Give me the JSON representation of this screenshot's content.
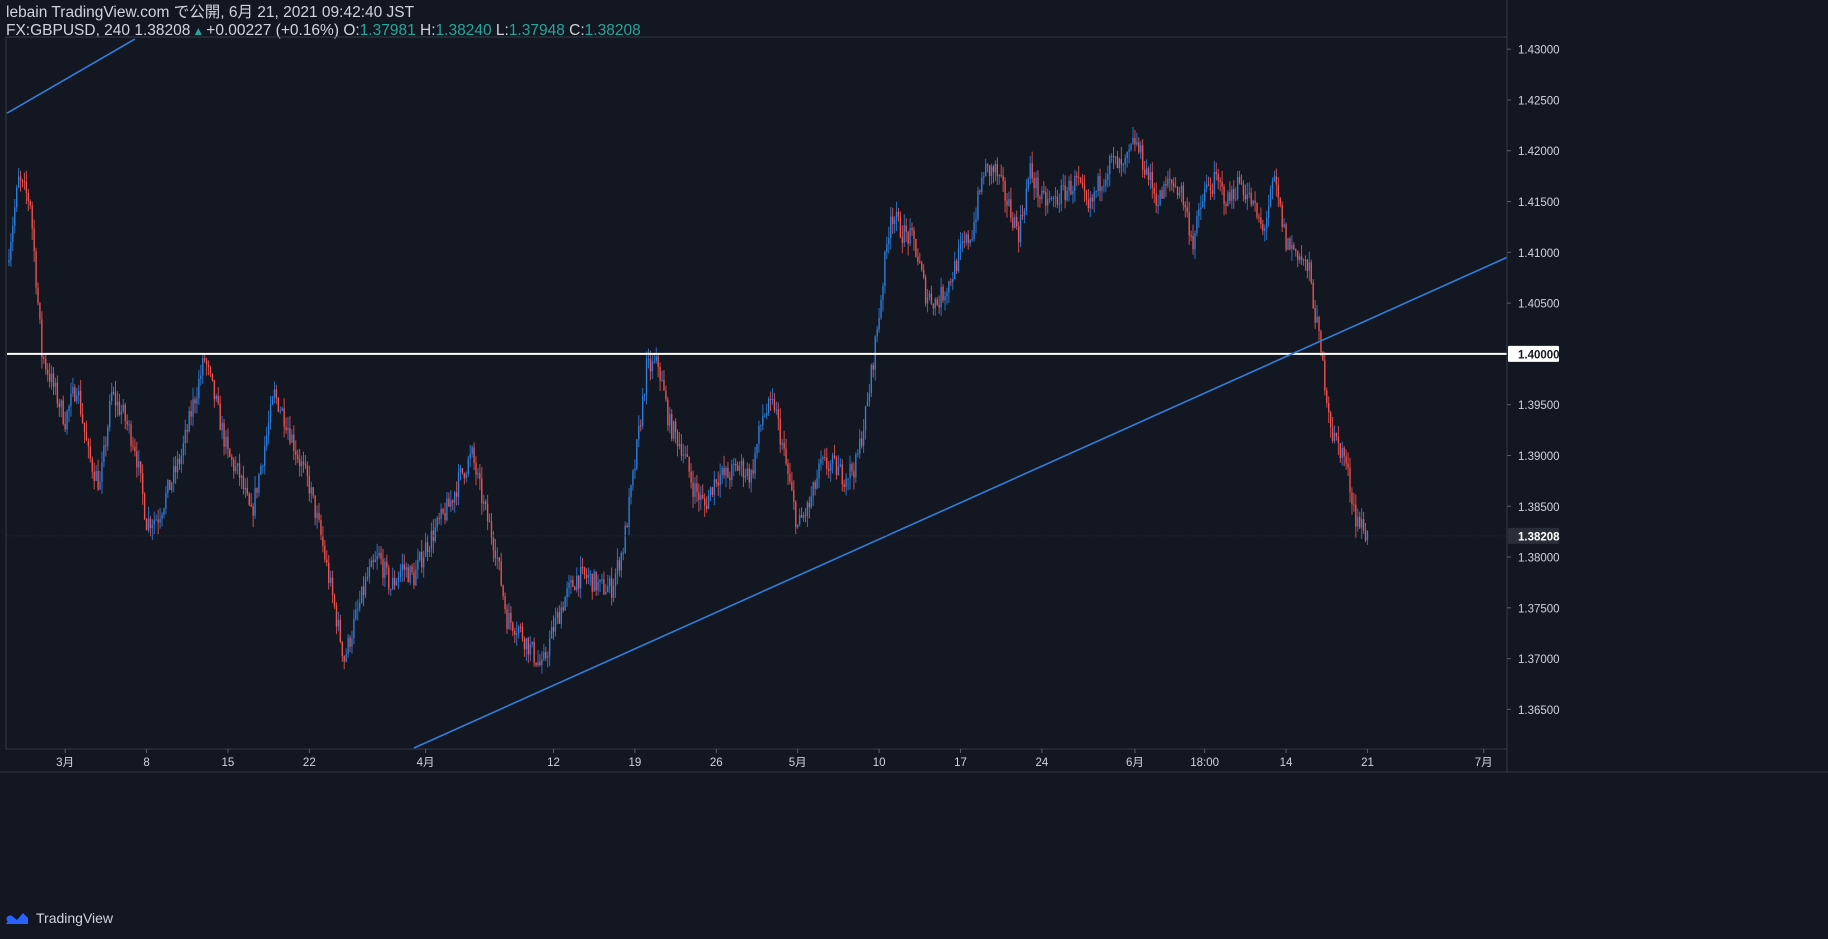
{
  "header": {
    "publisher": "lebain TradingView.com で公開, 6月 21, 2021 09:42:40 JST",
    "symbol": "FX:GBPUSD, 240",
    "last": "1.38208",
    "change": "+0.00227 (+0.16%)",
    "o_label": "O:",
    "o_value": "1.37981",
    "h_label": "H:",
    "h_value": "1.38240",
    "l_label": "L:",
    "l_value": "1.37948",
    "c_label": "C:",
    "c_value": "1.38208"
  },
  "footer": {
    "brand": "TradingView"
  },
  "colors": {
    "background": "#131722",
    "up": "#2f7fdc",
    "down": "#ef5350",
    "trendline": "#2f7fdc",
    "level": "#ffffff",
    "text": "#d1d4dc",
    "value_green": "#26a69a"
  },
  "chart_data": {
    "type": "candlestick",
    "symbol": "FX:GBPUSD",
    "timeframe": "240",
    "x_range": [
      "2021-02-24",
      "2021-07-03"
    ],
    "ylim": [
      1.3612,
      1.4311
    ],
    "y_ticks": [
      "1.43000",
      "1.42500",
      "1.42000",
      "1.41500",
      "1.41000",
      "1.40500",
      "1.40000",
      "1.39500",
      "1.39000",
      "1.38500",
      "1.38208",
      "1.38000",
      "1.37500",
      "1.37000",
      "1.36500"
    ],
    "highlighted_levels": [
      {
        "value": 1.4,
        "label": "1.40000",
        "style": "white"
      },
      {
        "value": 1.38208,
        "label": "1.38208",
        "style": "dark"
      }
    ],
    "x_ticks": [
      {
        "date": "2021-03-01",
        "label": "3月"
      },
      {
        "date": "2021-03-08",
        "label": "8"
      },
      {
        "date": "2021-03-15",
        "label": "15"
      },
      {
        "date": "2021-03-22",
        "label": "22"
      },
      {
        "date": "2021-04-01",
        "label": "4月"
      },
      {
        "date": "2021-04-12",
        "label": "12"
      },
      {
        "date": "2021-04-19",
        "label": "19"
      },
      {
        "date": "2021-04-26",
        "label": "26"
      },
      {
        "date": "2021-05-03",
        "label": "5月"
      },
      {
        "date": "2021-05-10",
        "label": "10"
      },
      {
        "date": "2021-05-17",
        "label": "17"
      },
      {
        "date": "2021-05-24",
        "label": "24"
      },
      {
        "date": "2021-06-01",
        "label": "6月"
      },
      {
        "date": "2021-06-07",
        "label": "18:00"
      },
      {
        "date": "2021-06-14",
        "label": "14"
      },
      {
        "date": "2021-06-21",
        "label": "21"
      },
      {
        "date": "2021-07-01",
        "label": "7月"
      }
    ],
    "trendlines": [
      {
        "name": "upper channel",
        "from": [
          "2021-02-24",
          1.4237
        ],
        "to": [
          "2021-03-07",
          1.431
        ]
      },
      {
        "name": "lower trendline",
        "from": [
          "2021-03-31",
          1.3612
        ],
        "to": [
          "2021-07-03",
          1.4095
        ]
      }
    ],
    "horizontal_lines": [
      1.4
    ],
    "close_path": [
      [
        "2021-02-24",
        1.409
      ],
      [
        "2021-02-25",
        1.417
      ],
      [
        "2021-02-26",
        1.415
      ],
      [
        "2021-02-27",
        1.4
      ],
      [
        "2021-03-01",
        1.3935
      ],
      [
        "2021-03-02",
        1.397
      ],
      [
        "2021-03-03",
        1.39
      ],
      [
        "2021-03-04",
        1.387
      ],
      [
        "2021-03-05",
        1.396
      ],
      [
        "2021-03-06",
        1.394
      ],
      [
        "2021-03-07",
        1.391
      ],
      [
        "2021-03-08",
        1.3835
      ],
      [
        "2021-03-09",
        1.384
      ],
      [
        "2021-03-10",
        1.387
      ],
      [
        "2021-03-11",
        1.39
      ],
      [
        "2021-03-12",
        1.395
      ],
      [
        "2021-03-13",
        1.3995
      ],
      [
        "2021-03-14",
        1.395
      ],
      [
        "2021-03-15",
        1.39
      ],
      [
        "2021-03-16",
        1.388
      ],
      [
        "2021-03-17",
        1.384
      ],
      [
        "2021-03-18",
        1.39
      ],
      [
        "2021-03-19",
        1.396
      ],
      [
        "2021-03-20",
        1.3935
      ],
      [
        "2021-03-21",
        1.39
      ],
      [
        "2021-03-22",
        1.387
      ],
      [
        "2021-03-23",
        1.382
      ],
      [
        "2021-03-24",
        1.376
      ],
      [
        "2021-03-25",
        1.37
      ],
      [
        "2021-03-26",
        1.374
      ],
      [
        "2021-03-27",
        1.378
      ],
      [
        "2021-03-28",
        1.38
      ],
      [
        "2021-03-29",
        1.377
      ],
      [
        "2021-03-30",
        1.379
      ],
      [
        "2021-03-31",
        1.378
      ],
      [
        "2021-04-01",
        1.381
      ],
      [
        "2021-04-02",
        1.383
      ],
      [
        "2021-04-03",
        1.385
      ],
      [
        "2021-04-04",
        1.388
      ],
      [
        "2021-04-05",
        1.39
      ],
      [
        "2021-04-06",
        1.385
      ],
      [
        "2021-04-07",
        1.381
      ],
      [
        "2021-04-08",
        1.374
      ],
      [
        "2021-04-09",
        1.373
      ],
      [
        "2021-04-10",
        1.371
      ],
      [
        "2021-04-11",
        1.369
      ],
      [
        "2021-04-12",
        1.373
      ],
      [
        "2021-04-13",
        1.376
      ],
      [
        "2021-04-14",
        1.378
      ],
      [
        "2021-04-15",
        1.378
      ],
      [
        "2021-04-16",
        1.377
      ],
      [
        "2021-04-17",
        1.377
      ],
      [
        "2021-04-18",
        1.381
      ],
      [
        "2021-04-19",
        1.389
      ],
      [
        "2021-04-20",
        1.3985
      ],
      [
        "2021-04-21",
        1.399
      ],
      [
        "2021-04-22",
        1.393
      ],
      [
        "2021-04-23",
        1.391
      ],
      [
        "2021-04-24",
        1.387
      ],
      [
        "2021-04-25",
        1.385
      ],
      [
        "2021-04-26",
        1.388
      ],
      [
        "2021-04-27",
        1.388
      ],
      [
        "2021-04-28",
        1.389
      ],
      [
        "2021-04-29",
        1.388
      ],
      [
        "2021-04-30",
        1.394
      ],
      [
        "2021-05-01",
        1.395
      ],
      [
        "2021-05-02",
        1.389
      ],
      [
        "2021-05-03",
        1.383
      ],
      [
        "2021-05-04",
        1.385
      ],
      [
        "2021-05-05",
        1.389
      ],
      [
        "2021-05-06",
        1.389
      ],
      [
        "2021-05-07",
        1.388
      ],
      [
        "2021-05-08",
        1.389
      ],
      [
        "2021-05-09",
        1.395
      ],
      [
        "2021-05-10",
        1.404
      ],
      [
        "2021-05-11",
        1.414
      ],
      [
        "2021-05-12",
        1.412
      ],
      [
        "2021-05-13",
        1.411
      ],
      [
        "2021-05-14",
        1.406
      ],
      [
        "2021-05-15",
        1.405
      ],
      [
        "2021-05-16",
        1.407
      ],
      [
        "2021-05-17",
        1.41
      ],
      [
        "2021-05-18",
        1.412
      ],
      [
        "2021-05-19",
        1.418
      ],
      [
        "2021-05-20",
        1.418
      ],
      [
        "2021-05-21",
        1.415
      ],
      [
        "2021-05-22",
        1.412
      ],
      [
        "2021-05-23",
        1.418
      ],
      [
        "2021-05-24",
        1.415
      ],
      [
        "2021-05-25",
        1.415
      ],
      [
        "2021-05-26",
        1.416
      ],
      [
        "2021-05-27",
        1.417
      ],
      [
        "2021-05-28",
        1.414
      ],
      [
        "2021-05-29",
        1.417
      ],
      [
        "2021-05-30",
        1.419
      ],
      [
        "2021-05-31",
        1.418
      ],
      [
        "2021-06-01",
        1.421
      ],
      [
        "2021-06-02",
        1.418
      ],
      [
        "2021-06-03",
        1.415
      ],
      [
        "2021-06-04",
        1.417
      ],
      [
        "2021-06-05",
        1.416
      ],
      [
        "2021-06-06",
        1.411
      ],
      [
        "2021-06-07",
        1.416
      ],
      [
        "2021-06-08",
        1.417
      ],
      [
        "2021-06-09",
        1.415
      ],
      [
        "2021-06-10",
        1.417
      ],
      [
        "2021-06-11",
        1.415
      ],
      [
        "2021-06-12",
        1.412
      ],
      [
        "2021-06-13",
        1.417
      ],
      [
        "2021-06-14",
        1.411
      ],
      [
        "2021-06-15",
        1.41
      ],
      [
        "2021-06-16",
        1.408
      ],
      [
        "2021-06-17",
        1.4
      ],
      [
        "2021-06-18",
        1.392
      ],
      [
        "2021-06-19",
        1.39
      ],
      [
        "2021-06-20",
        1.384
      ],
      [
        "2021-06-21",
        1.3821
      ]
    ]
  }
}
